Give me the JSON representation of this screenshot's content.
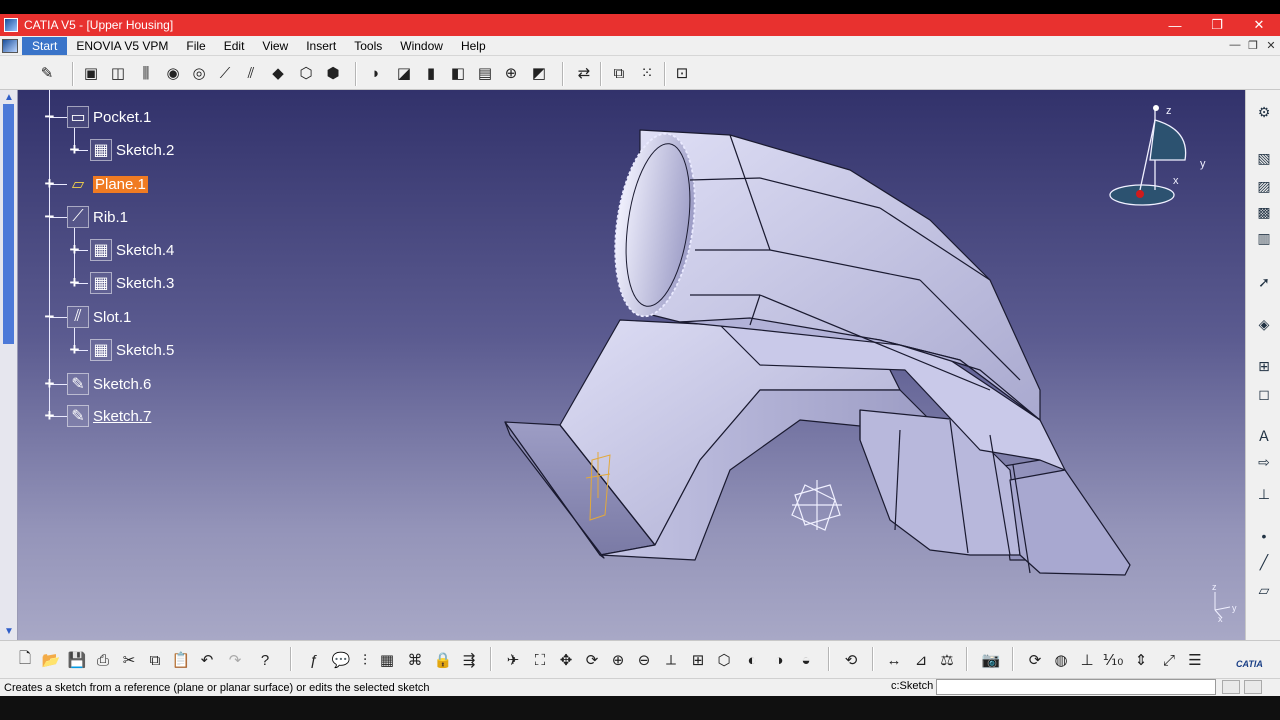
{
  "window": {
    "title": "CATIA V5 - [Upper Housing]",
    "minimize": "—",
    "maximize": "❐",
    "close": "✕"
  },
  "menu": {
    "items": [
      "Start",
      "ENOVIA V5 VPM",
      "File",
      "Edit",
      "View",
      "Insert",
      "Tools",
      "Window",
      "Help"
    ],
    "mdi_min": "—",
    "mdi_restore": "❐",
    "mdi_close": "✕"
  },
  "tree": {
    "nodes": [
      {
        "label": "Pocket.1",
        "icon": "pocket-icon"
      },
      {
        "label": "Sketch.2",
        "icon": "sketch-icon"
      },
      {
        "label": "Plane.1",
        "icon": "plane-icon",
        "selected": true
      },
      {
        "label": "Rib.1",
        "icon": "rib-icon"
      },
      {
        "label": "Sketch.4",
        "icon": "sketch-icon"
      },
      {
        "label": "Sketch.3",
        "icon": "sketch-icon"
      },
      {
        "label": "Slot.1",
        "icon": "slot-icon"
      },
      {
        "label": "Sketch.5",
        "icon": "sketch-icon"
      },
      {
        "label": "Sketch.6",
        "icon": "sketch-icon"
      },
      {
        "label": "Sketch.7",
        "icon": "sketch-icon",
        "underline": true
      }
    ]
  },
  "compass": {
    "z": "z",
    "y": "y",
    "x": "x"
  },
  "axis_small": {
    "z": "z",
    "y": "y",
    "x": "x"
  },
  "status": {
    "message": "Creates a sketch from a reference (plane or planar surface) or edits the selected sketch",
    "command_label": "c:Sketch",
    "command_value": ""
  },
  "logo": "CATIA",
  "colors": {
    "title_bar": "#e8312f",
    "selection": "#f07b22",
    "background_top": "#32326b",
    "part_surface": "#c8c8e6"
  }
}
